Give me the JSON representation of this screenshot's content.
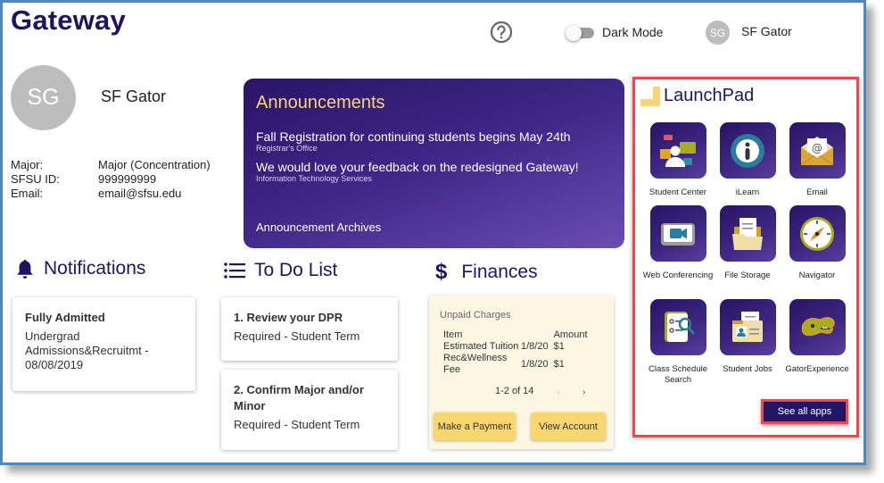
{
  "header": {
    "app_title": "Gateway",
    "dark_mode_label": "Dark Mode",
    "dark_mode_on": false,
    "user_initials": "SG",
    "user_name": "SF Gator"
  },
  "profile": {
    "initials": "SG",
    "name": "SF Gator",
    "fields": [
      {
        "label": "Major:",
        "value": "Major (Concentration)"
      },
      {
        "label": "SFSU ID:",
        "value": "999999999"
      },
      {
        "label": "Email:",
        "value": "email@sfsu.edu"
      }
    ]
  },
  "announcements": {
    "title": "Announcements",
    "items": [
      {
        "title": "Fall Registration for continuing students begins May 24th",
        "source": "Registrar's Office"
      },
      {
        "title": "We would love your feedback on the redesigned Gateway!",
        "source": "Information Technology Services"
      }
    ],
    "archives_link": "Announcement Archives"
  },
  "notifications": {
    "title": "Notifications",
    "items": [
      {
        "title": "Fully Admitted",
        "body": "Undergrad Admissions&Recruitmt - 08/08/2019"
      }
    ]
  },
  "todo": {
    "title": "To Do List",
    "items": [
      {
        "title": "1. Review your DPR",
        "body": "Required - Student Term"
      },
      {
        "title": "2. Confirm Major and/or Minor",
        "body": "Required - Student Term"
      }
    ]
  },
  "finances": {
    "title": "Finances",
    "caption": "Unpaid Charges",
    "columns": [
      "Item",
      "",
      "Amount"
    ],
    "rows": [
      {
        "item": "Estimated Tuition",
        "date": "1/8/20",
        "amount": "$1"
      },
      {
        "item": "Rec&Wellness Fee",
        "date": "1/8/20",
        "amount": "$1"
      }
    ],
    "pager": "1-2 of 14",
    "prev_label": "‹",
    "next_label": "›",
    "pay_button": "Make a Payment",
    "view_button": "View Account"
  },
  "launchpad": {
    "title": "LaunchPad",
    "apps": [
      {
        "label": "Student Center",
        "icon": "student-center-icon"
      },
      {
        "label": "iLearn",
        "icon": "ilearn-icon"
      },
      {
        "label": "Email",
        "icon": "email-icon"
      },
      {
        "label": "Web Conferencing",
        "icon": "web-conferencing-icon"
      },
      {
        "label": "File Storage",
        "icon": "file-storage-icon"
      },
      {
        "label": "Navigator",
        "icon": "navigator-icon"
      },
      {
        "label": "Class Schedule Search",
        "icon": "class-schedule-search-icon"
      },
      {
        "label": "Student Jobs",
        "icon": "student-jobs-icon"
      },
      {
        "label": "GatorExperience",
        "icon": "gator-experience-icon"
      }
    ],
    "see_all_label": "See all apps"
  },
  "colors": {
    "brand_purple": "#231260",
    "accent_gold": "#f9d66f",
    "highlight_red": "#e84a4f",
    "frame_blue": "#4f87c0"
  }
}
